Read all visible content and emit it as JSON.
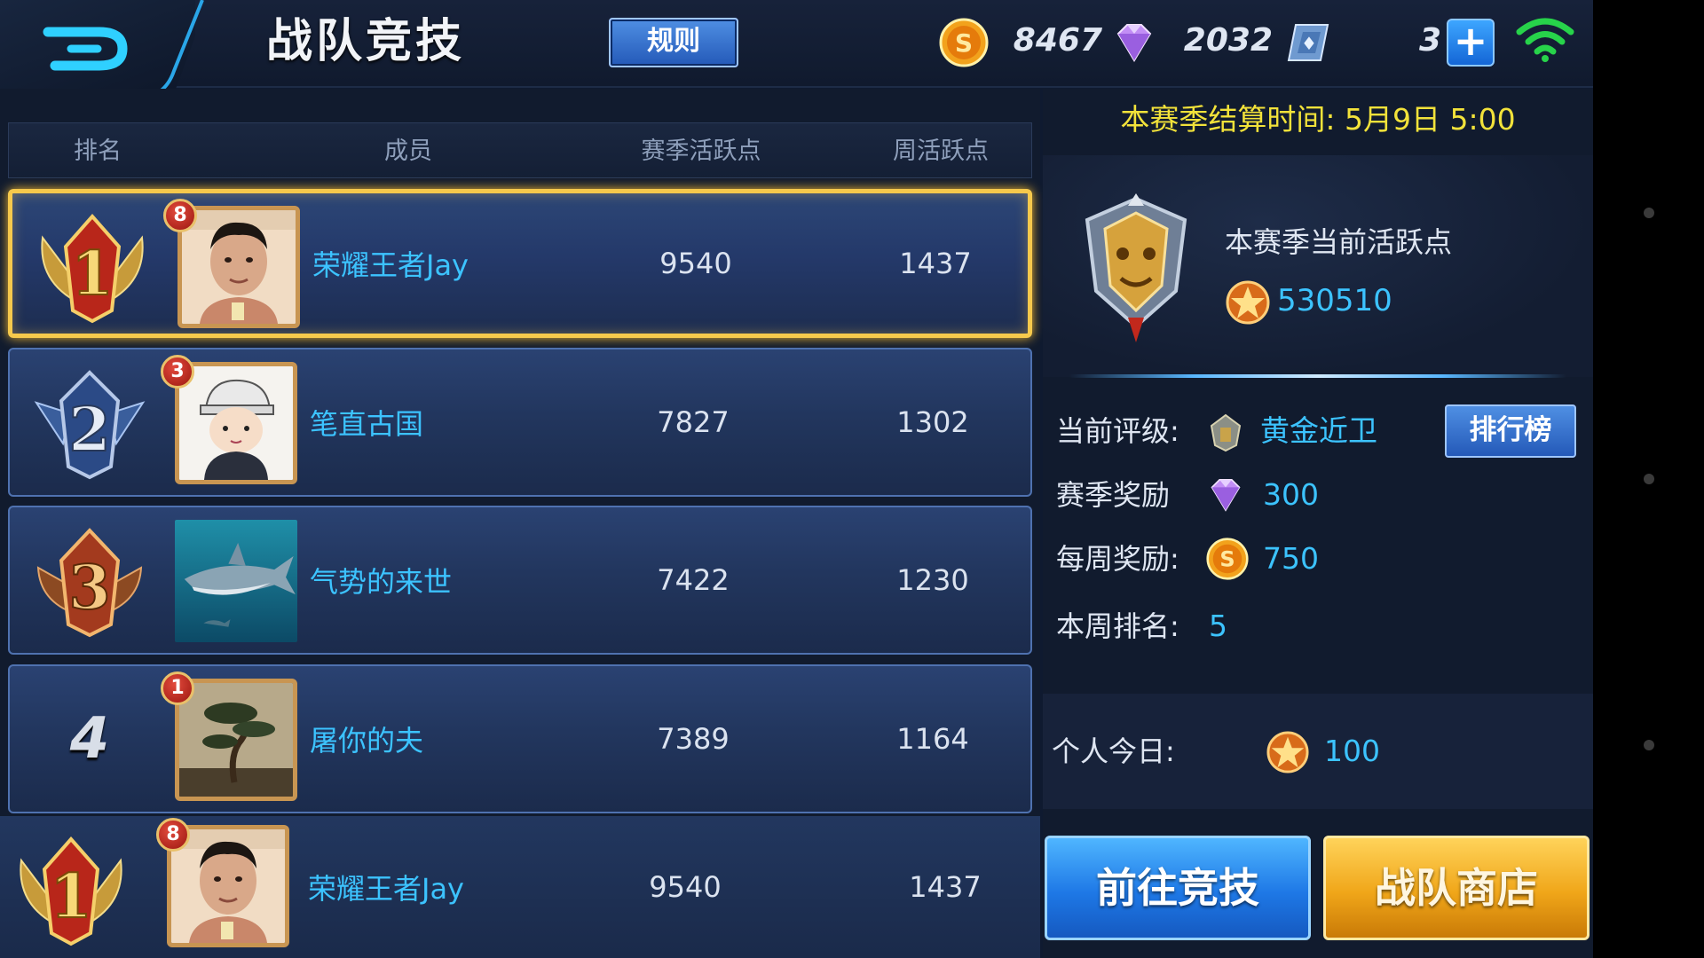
{
  "header": {
    "title": "战队竞技",
    "rules_label": "规则",
    "gold": "8467",
    "diamonds": "2032",
    "vouchers": "3",
    "plus_label": "+"
  },
  "table": {
    "headers": [
      "排名",
      "成员",
      "赛季活跃点",
      "周活跃点"
    ],
    "rows": [
      {
        "rank": "1",
        "level": "8",
        "name": "荣耀王者Jay",
        "season": "9540",
        "weekly": "1437",
        "avatar_icon": "man-portrait-icon"
      },
      {
        "rank": "2",
        "level": "3",
        "name": "笔直古国",
        "season": "7827",
        "weekly": "1302",
        "avatar_icon": "cartoon-boy-icon"
      },
      {
        "rank": "3",
        "level": "",
        "name": "气势的来世",
        "season": "7422",
        "weekly": "1230",
        "avatar_icon": "shark-icon"
      },
      {
        "rank": "4",
        "level": "1",
        "name": "屠你的夫",
        "season": "7389",
        "weekly": "1164",
        "avatar_icon": "bonsai-tree-icon"
      }
    ],
    "my_row": {
      "rank": "1",
      "level": "8",
      "name": "荣耀王者Jay",
      "season": "9540",
      "weekly": "1437"
    }
  },
  "side": {
    "settlement": "本赛季结算时间: 5月9日 5:00",
    "score_label": "本赛季当前活跃点",
    "score_value": "530510",
    "rating_label": "当前评级:",
    "rating_value": "黄金近卫",
    "leaderboard_label": "排行榜",
    "season_reward_label": "赛季奖励",
    "season_reward_value": "300",
    "weekly_reward_label": "每周奖励:",
    "weekly_reward_value": "750",
    "week_rank_label": "本周排名:",
    "week_rank_value": "5",
    "today_label": "个人今日:",
    "today_value": "100",
    "go_compete_label": "前往竞技",
    "shop_label": "战队商店"
  },
  "colors": {
    "accent_blue": "#3cc3ff",
    "highlight_gold": "#f6c94c",
    "settlement_yellow": "#f2e23a"
  }
}
